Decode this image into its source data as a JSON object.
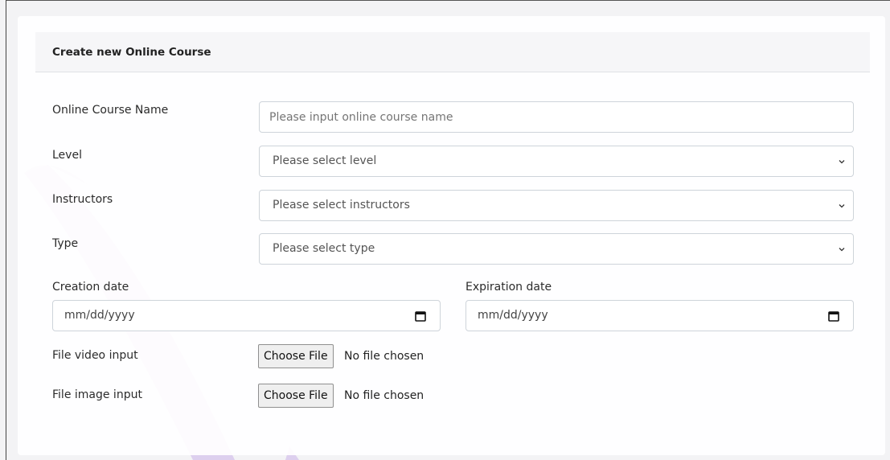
{
  "form": {
    "title": "Create new Online Course",
    "name": {
      "label": "Online Course Name",
      "placeholder": "Please input online course name"
    },
    "level": {
      "label": "Level",
      "value": "Please select level"
    },
    "instructors": {
      "label": "Instructors",
      "value": "Please select instructors"
    },
    "type": {
      "label": "Type",
      "value": "Please select type"
    },
    "creation_date": {
      "label": "Creation date",
      "value": "mm/dd/yyyy"
    },
    "expiration_date": {
      "label": "Expiration date",
      "value": "mm/dd/yyyy"
    },
    "video": {
      "label": "File video input",
      "button": "Choose File",
      "status": "No file chosen"
    },
    "image": {
      "label": "File image input",
      "button": "Choose File",
      "status": "No file chosen"
    }
  },
  "colors": {
    "background": "#f3f3f5",
    "watermark": "#7b3fd1",
    "border": "#ced4da"
  },
  "icons": {
    "select_arrow": "chevron-down-icon",
    "date_picker": "calendar-icon"
  }
}
